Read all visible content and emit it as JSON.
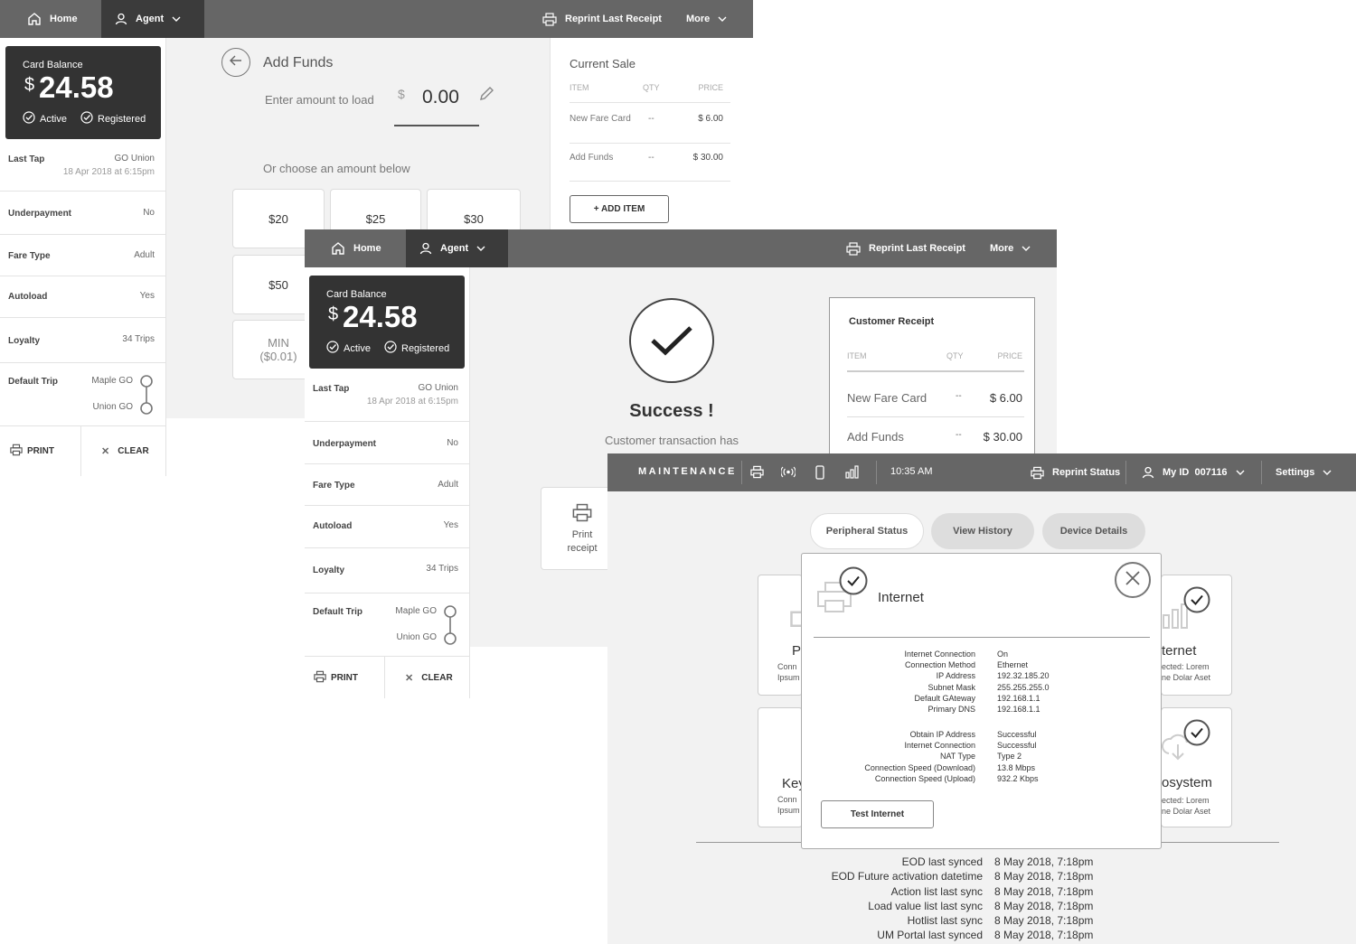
{
  "screen1": {
    "nav": {
      "home": "Home",
      "agent": "Agent",
      "reprint": "Reprint Last Receipt",
      "more": "More"
    },
    "card": {
      "title": "Card Balance",
      "currency": "$",
      "amount": "24.58",
      "active": "Active",
      "registered": "Registered"
    },
    "last_tap": {
      "label": "Last Tap",
      "station": "GO Union",
      "time": "18 Apr 2018 at 6:15pm"
    },
    "rows": [
      {
        "label": "Underpayment",
        "value": "No"
      },
      {
        "label": "Fare Type",
        "value": "Adult"
      },
      {
        "label": "Autoload",
        "value": "Yes"
      },
      {
        "label": "Loyalty",
        "value": "34 Trips"
      }
    ],
    "default_trip": {
      "label": "Default Trip",
      "from": "Maple GO",
      "to": "Union GO"
    },
    "print": "PRINT",
    "clear": "CLEAR",
    "add_funds": {
      "title": "Add Funds",
      "enter_label": "Enter amount to load",
      "currency": "$",
      "amount": "0.00",
      "choose": "Or choose an amount below",
      "amounts": [
        "$20",
        "$25",
        "$30",
        "$50"
      ],
      "min_label": "MIN",
      "min_value": "($0.01)"
    },
    "sale": {
      "title": "Current Sale",
      "headers": {
        "item": "ITEM",
        "qty": "QTY",
        "price": "PRICE"
      },
      "items": [
        {
          "name": "New Fare Card",
          "qty": "--",
          "price": "$ 6.00"
        },
        {
          "name": "Add Funds",
          "qty": "--",
          "price": "$ 30.00"
        }
      ],
      "add_item": "+ ADD ITEM"
    }
  },
  "screen2": {
    "nav": {
      "home": "Home",
      "agent": "Agent",
      "reprint": "Reprint Last Receipt",
      "more": "More"
    },
    "card": {
      "title": "Card Balance",
      "currency": "$",
      "amount": "24.58",
      "active": "Active",
      "registered": "Registered"
    },
    "last_tap": {
      "label": "Last Tap",
      "station": "GO Union",
      "time": "18 Apr 2018 at 6:15pm"
    },
    "rows": [
      {
        "label": "Underpayment",
        "value": "No"
      },
      {
        "label": "Fare Type",
        "value": "Adult"
      },
      {
        "label": "Autoload",
        "value": "Yes"
      },
      {
        "label": "Loyalty",
        "value": "34 Trips"
      }
    ],
    "default_trip": {
      "label": "Default Trip",
      "from": "Maple GO",
      "to": "Union GO"
    },
    "print": "PRINT",
    "clear": "CLEAR",
    "success": {
      "title": "Success !",
      "message": "Customer transaction has"
    },
    "print_receipt": {
      "line1": "Print",
      "line2": "receipt"
    },
    "receipt": {
      "title": "Customer Receipt",
      "headers": {
        "item": "ITEM",
        "qty": "QTY",
        "price": "PRICE"
      },
      "items": [
        {
          "name": "New Fare Card",
          "qty": "--",
          "price": "$ 6.00"
        },
        {
          "name": "Add Funds",
          "qty": "--",
          "price": "$ 30.00"
        }
      ]
    }
  },
  "screen3": {
    "nav": {
      "title": "MAINTENANCE",
      "time": "10:35 AM",
      "reprint": "Reprint Status",
      "my_id": "My ID  007116",
      "settings": "Settings"
    },
    "tabs": [
      "Peripheral Status",
      "View History",
      "Device Details"
    ],
    "cards_left": [
      {
        "title": "P",
        "desc1": "Conn",
        "desc2": "Ipsum"
      },
      {
        "title": "Key",
        "desc1": "Conn",
        "desc2": "Ipsum"
      }
    ],
    "cards_right": [
      {
        "title": "ternet",
        "desc1": "ected: Lorem",
        "desc2": "ne Dolar Aset"
      },
      {
        "title": "osystem",
        "desc1": "ected: Lorem",
        "desc2": "ne Dolar Aset"
      }
    ],
    "modal": {
      "title": "Internet",
      "group1": [
        {
          "k": "Internet Connection",
          "v": "On"
        },
        {
          "k": "Connection Method",
          "v": "Ethernet"
        },
        {
          "k": "IP Address",
          "v": "192.32.185.20"
        },
        {
          "k": "Subnet Mask",
          "v": "255.255.255.0"
        },
        {
          "k": "Default GAteway",
          "v": "192.168.1.1"
        },
        {
          "k": "Primary DNS",
          "v": "192.168.1.1"
        }
      ],
      "group2": [
        {
          "k": "Obtain IP Address",
          "v": "Successful"
        },
        {
          "k": "Internet Connection",
          "v": "Successful"
        },
        {
          "k": "NAT Type",
          "v": "Type 2"
        },
        {
          "k": "Connection Speed (Download)",
          "v": "13.8 Mbps"
        },
        {
          "k": "Connection Speed (Upload)",
          "v": "932.2 Kbps"
        }
      ],
      "test_button": "Test Internet"
    },
    "eod": [
      {
        "k": "EOD last synced",
        "v": "8 May 2018, 7:18pm"
      },
      {
        "k": "EOD Future activation datetime",
        "v": "8 May 2018, 7:18pm"
      },
      {
        "k": "Action list last sync",
        "v": "8 May 2018, 7:18pm"
      },
      {
        "k": "Load value list last sync",
        "v": "8 May 2018, 7:18pm"
      },
      {
        "k": "Hotlist last sync",
        "v": "8 May 2018, 7:18pm"
      },
      {
        "k": "UM Portal last synced",
        "v": "8 May 2018, 7:18pm"
      }
    ]
  }
}
